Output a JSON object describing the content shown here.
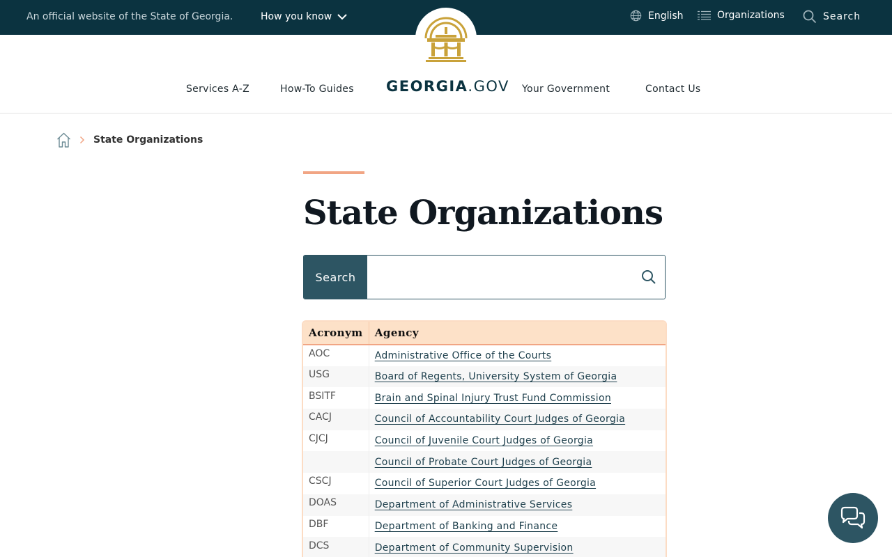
{
  "topbar": {
    "official_text": "An official website of the State of Georgia.",
    "how_you_know": "How you know",
    "language": "English",
    "organizations": "Organizations",
    "search": "Search"
  },
  "nav": {
    "brand_bold": "GEORGIA",
    "brand_suffix": ".GOV",
    "items": [
      "Services A-Z",
      "How-To Guides",
      "Your Government",
      "Contact Us"
    ]
  },
  "breadcrumb": {
    "current": "State Organizations"
  },
  "page": {
    "title": "State Organizations",
    "search_button": "Search",
    "search_placeholder": ""
  },
  "table": {
    "headers": [
      "Acronym",
      "Agency"
    ],
    "rows": [
      {
        "acronym": "AOC",
        "agency": "Administrative Office of the Courts"
      },
      {
        "acronym": "USG",
        "agency": "Board of Regents, University System of Georgia"
      },
      {
        "acronym": "BSITF",
        "agency": "Brain and Spinal Injury Trust Fund Commission"
      },
      {
        "acronym": "CACJ",
        "agency": "Council of Accountability Court Judges of Georgia"
      },
      {
        "acronym": "CJCJ",
        "agency": "Council of Juvenile Court Judges of Georgia"
      },
      {
        "acronym": "",
        "agency": "Council of Probate Court Judges of Georgia"
      },
      {
        "acronym": "CSCJ",
        "agency": "Council of Superior Court Judges of Georgia"
      },
      {
        "acronym": "DOAS",
        "agency": "Department of Administrative Services"
      },
      {
        "acronym": "DBF",
        "agency": "Department of Banking and Finance"
      },
      {
        "acronym": "DCS",
        "agency": "Department of Community Supervision"
      }
    ]
  },
  "colors": {
    "topbar_bg": "#0b3340",
    "accent": "#f1a584",
    "button_bg": "#2d5563",
    "table_header_bg": "#fde1c8",
    "seal_gold": "#c9a23a"
  }
}
